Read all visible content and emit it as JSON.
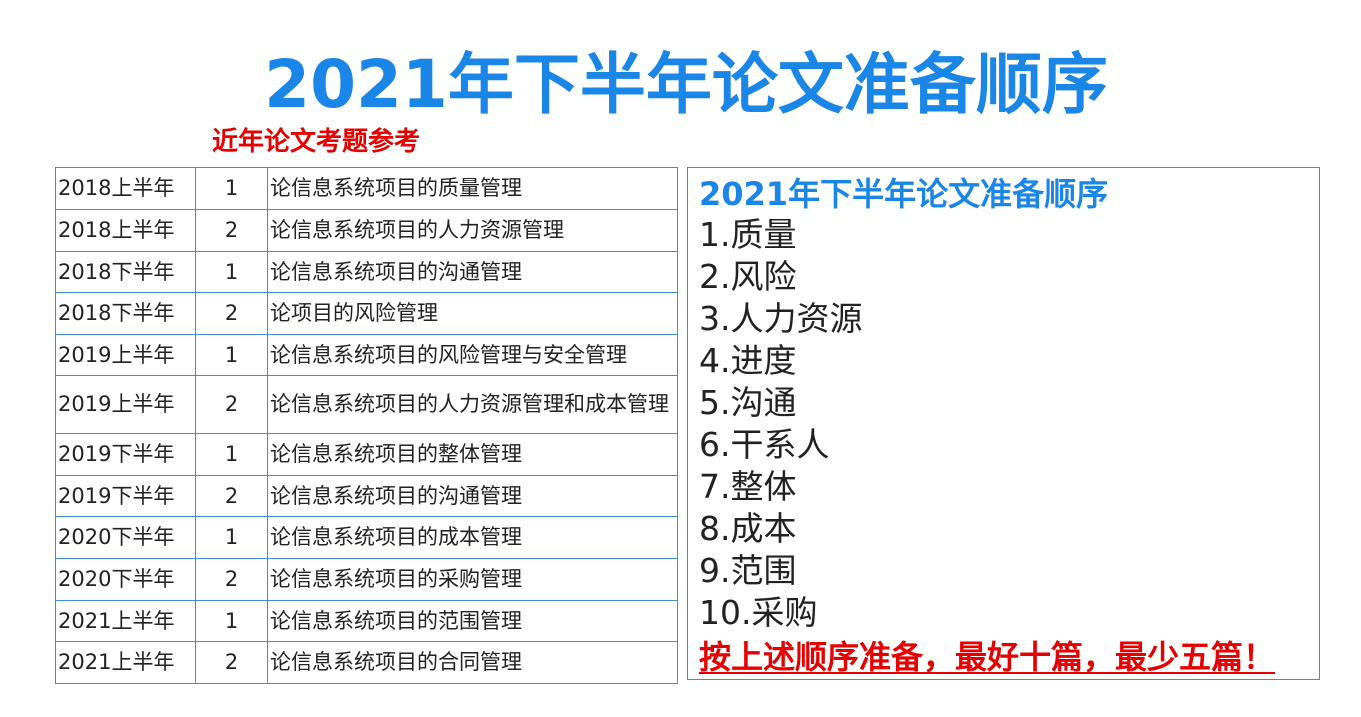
{
  "title": "2021年下半年论文准备顺序",
  "reference_label": "近年论文考题参考",
  "exam_topics": [
    {
      "period": "2018上半年",
      "number": "1",
      "topic": "论信息系统项目的质量管理"
    },
    {
      "period": "2018上半年",
      "number": "2",
      "topic": "论信息系统项目的人力资源管理"
    },
    {
      "period": "2018下半年",
      "number": "1",
      "topic": "论信息系统项目的沟通管理"
    },
    {
      "period": "2018下半年",
      "number": "2",
      "topic": "论项目的风险管理"
    },
    {
      "period": "2019上半年",
      "number": "1",
      "topic": "论信息系统项目的风险管理与安全管理"
    },
    {
      "period": "2019上半年",
      "number": "2",
      "topic": "论信息系统项目的人力资源管理和成本管理"
    },
    {
      "period": "2019下半年",
      "number": "1",
      "topic": "论信息系统项目的整体管理"
    },
    {
      "period": "2019下半年",
      "number": "2",
      "topic": "论信息系统项目的沟通管理"
    },
    {
      "period": "2020下半年",
      "number": "1",
      "topic": "论信息系统项目的成本管理"
    },
    {
      "period": "2020下半年",
      "number": "2",
      "topic": "论信息系统项目的采购管理"
    },
    {
      "period": "2021上半年",
      "number": "1",
      "topic": "论信息系统项目的范围管理"
    },
    {
      "period": "2021上半年",
      "number": "2",
      "topic": "论信息系统项目的合同管理"
    }
  ],
  "order_box": {
    "title": "2021年下半年论文准备顺序",
    "items": [
      "1.质量",
      "2.风险",
      "3.人力资源",
      "4.进度",
      "5.沟通",
      "6.干系人",
      "7.整体",
      "8.成本",
      "9.范围",
      "10.采购"
    ],
    "note": "按上述顺序准备，最好十篇，最少五篇！"
  },
  "colors": {
    "title": "#1a86e8",
    "reference_label": "#e60000",
    "table_border": "#3b8fd6",
    "order_title": "#1a86e8",
    "body_text": "#222222",
    "note": "#e60000"
  }
}
